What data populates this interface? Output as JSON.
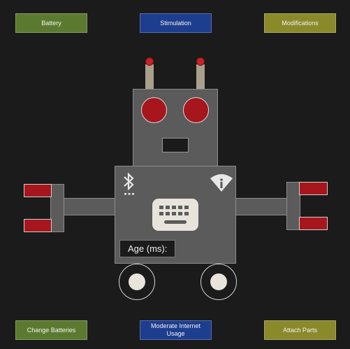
{
  "buttons": {
    "battery": "Battery",
    "stimulation": "Stimulation",
    "modifications": "Modifications",
    "change_batteries": "Change Batteries",
    "internet_usage": "Moderate Internet Usage",
    "attach_parts": "Attach Parts"
  },
  "robot": {
    "age_label": "Age (ms):"
  },
  "icons": {
    "status_left": "bluetooth-icon",
    "status_right": "wifi-info-icon",
    "chest": "keyboard-icon"
  },
  "colors": {
    "background": "#1b1b1b",
    "robot_body": "#5a5b5a",
    "button_green": "#5b7a2f",
    "button_blue": "#1d3d8f",
    "button_olive": "#8a8a2b",
    "accent_red": "#a6161c"
  }
}
